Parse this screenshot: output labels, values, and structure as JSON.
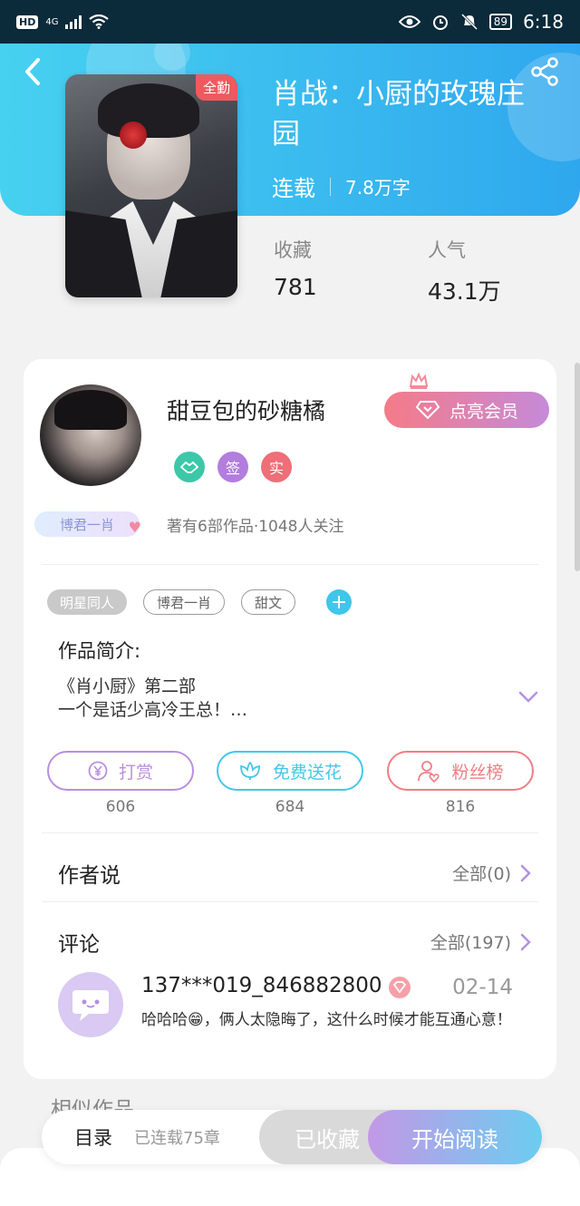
{
  "status_bar": {
    "hd": "HD",
    "network": "4G",
    "battery": "89",
    "time": "6:18"
  },
  "book": {
    "title": "肖战：小厨的玫瑰庄园",
    "status": "连载",
    "word_count": "7.8万字",
    "badge": "全勤",
    "favorites_label": "收藏",
    "favorites_value": "781",
    "popularity_label": "人气",
    "popularity_value": "43.1万"
  },
  "author": {
    "name": "甜豆包的砂糖橘",
    "vip_button": "点亮会员",
    "badge_sign": "签",
    "badge_real": "实",
    "fan_tag": "博君一肖",
    "stats": "著有6部作品·1048人关注"
  },
  "tags": [
    "明星同人",
    "博君一肖",
    "甜文"
  ],
  "intro": {
    "title": "作品简介:",
    "line1": "《肖小厨》第二部",
    "line2": "一个是话少高冷王总！…"
  },
  "actions": [
    {
      "label": "打赏",
      "count": "606",
      "color": "#b98fe0"
    },
    {
      "label": "免费送花",
      "count": "684",
      "color": "#43c7ea"
    },
    {
      "label": "粉丝榜",
      "count": "816",
      "color": "#ef7e85"
    }
  ],
  "author_says": {
    "title": "作者说",
    "more": "全部(0)"
  },
  "comments": {
    "title": "评论",
    "more": "全部(197)",
    "items": [
      {
        "user": "137***019_846882800",
        "date": "02-14",
        "text": "哈哈哈😁，俩人太隐晦了，这什么时候才能互通心意！"
      }
    ]
  },
  "similar_title": "相似作品",
  "bottom_bar": {
    "toc_label": "目录",
    "chapters": "已连载75章",
    "collected": "已收藏",
    "read": "开始阅读"
  },
  "colors": {
    "header_start": "#47d1f0",
    "header_end": "#2fa7ee",
    "vip_start": "#f57b88",
    "vip_end": "#c58ad9",
    "accent_blue": "#3fc6ea"
  },
  "icons": [
    "back-arrow-icon",
    "share-icon",
    "crown-icon",
    "diamond-icon",
    "handshake-badge-icon",
    "yen-icon",
    "flower-icon",
    "fans-icon",
    "chevron-right-icon",
    "chevron-down-icon",
    "chat-bubble-icon",
    "level-diamond-icon"
  ]
}
